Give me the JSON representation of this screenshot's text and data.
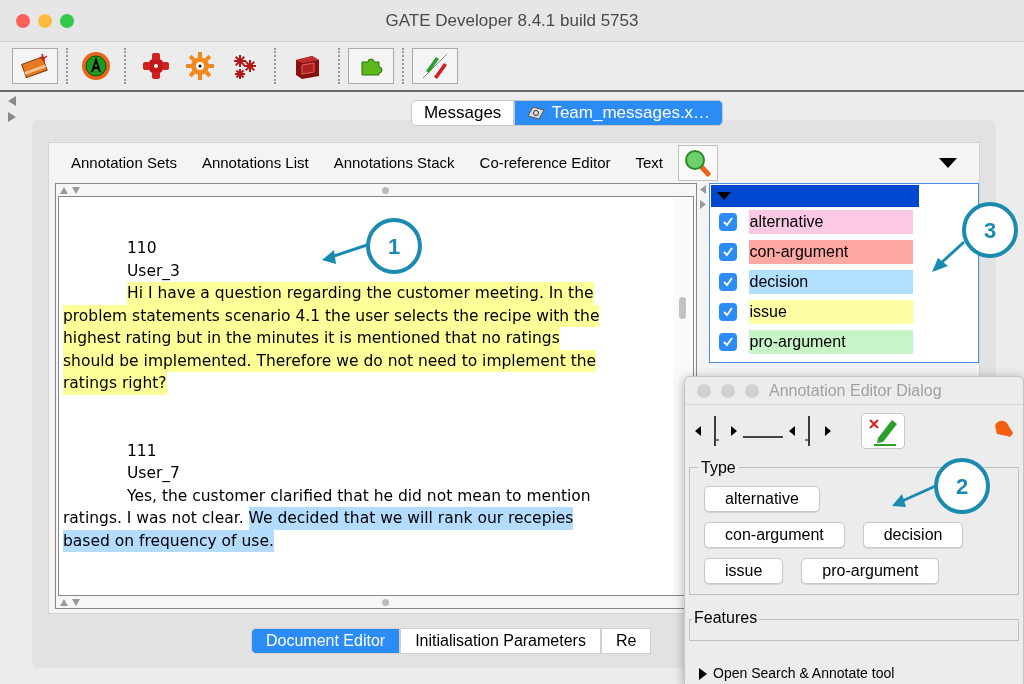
{
  "window": {
    "title": "GATE Developer 8.4.1 build 5753"
  },
  "document_tabs": [
    {
      "label": "Messages",
      "selected": false,
      "kind": "plain"
    },
    {
      "label": "Team_messages.x…",
      "selected": true,
      "kind": "document"
    }
  ],
  "view_tabs": [
    {
      "label": "Annotation Sets"
    },
    {
      "label": "Annotations List"
    },
    {
      "label": "Annotations Stack"
    },
    {
      "label": "Co-reference Editor"
    },
    {
      "label": "Text"
    }
  ],
  "document_text": [
    {
      "lines": [
        {
          "indent": true,
          "segments": [
            {
              "text": "110"
            }
          ]
        },
        {
          "indent": true,
          "segments": [
            {
              "text": "User_3"
            }
          ]
        },
        {
          "indent": true,
          "segments": [
            {
              "text": "Hi I have a question regarding the customer meeting. In the",
              "color": "#ffff99"
            }
          ]
        },
        {
          "indent": false,
          "segments": [
            {
              "text": "problem statements scenario 4.1 the user selects the recipe with the",
              "color": "#ffff99"
            }
          ]
        },
        {
          "indent": false,
          "segments": [
            {
              "text": "highest rating but in the minutes it is mentioned that no ratings",
              "color": "#ffff99"
            }
          ]
        },
        {
          "indent": false,
          "segments": [
            {
              "text": "should be implemented. Therefore we do not need to implement the",
              "color": "#ffff99"
            }
          ]
        },
        {
          "indent": false,
          "segments": [
            {
              "text": "ratings right?",
              "color": "#ffff99"
            }
          ]
        }
      ]
    },
    {
      "lines": [
        {
          "indent": true,
          "segments": [
            {
              "text": "111"
            }
          ]
        },
        {
          "indent": true,
          "segments": [
            {
              "text": "User_7"
            }
          ]
        },
        {
          "indent": true,
          "segments": [
            {
              "text": "Yes, the customer clarified that he did not mean to mention"
            }
          ]
        },
        {
          "indent": false,
          "segments": [
            {
              "text": "ratings. I was not clear. "
            },
            {
              "text": "We decided that we will rank our recepies",
              "color": "#b4dcff"
            }
          ]
        },
        {
          "indent": false,
          "segments": [
            {
              "text": "based on frequency of use.",
              "color": "#b4dcff"
            }
          ]
        }
      ]
    }
  ],
  "annotation_types": [
    {
      "name": "alternative",
      "checked": true,
      "color": "#fbc9e3"
    },
    {
      "name": "con-argument",
      "checked": true,
      "color": "#ffa8a3"
    },
    {
      "name": "decision",
      "checked": true,
      "color": "#b1dfff"
    },
    {
      "name": "issue",
      "checked": true,
      "color": "#fffda3"
    },
    {
      "name": "pro-argument",
      "checked": true,
      "color": "#c8f5c8"
    }
  ],
  "bottom_tabs": [
    {
      "label": "Document Editor",
      "selected": true
    },
    {
      "label": "Initialisation Parameters",
      "selected": false
    },
    {
      "label": "Re",
      "selected": false
    }
  ],
  "dialog": {
    "title": "Annotation Editor Dialog",
    "type_label": "Type",
    "type_rows": [
      [
        {
          "label": "alternative"
        }
      ],
      [
        {
          "label": "con-argument"
        },
        {
          "label": "decision"
        }
      ],
      [
        {
          "label": "issue"
        },
        {
          "label": "pro-argument"
        }
      ]
    ],
    "features_label": "Features",
    "search_toggle": "Open Search & Annotate tool"
  },
  "callouts": [
    {
      "number": "1"
    },
    {
      "number": "2"
    },
    {
      "number": "3"
    }
  ]
}
